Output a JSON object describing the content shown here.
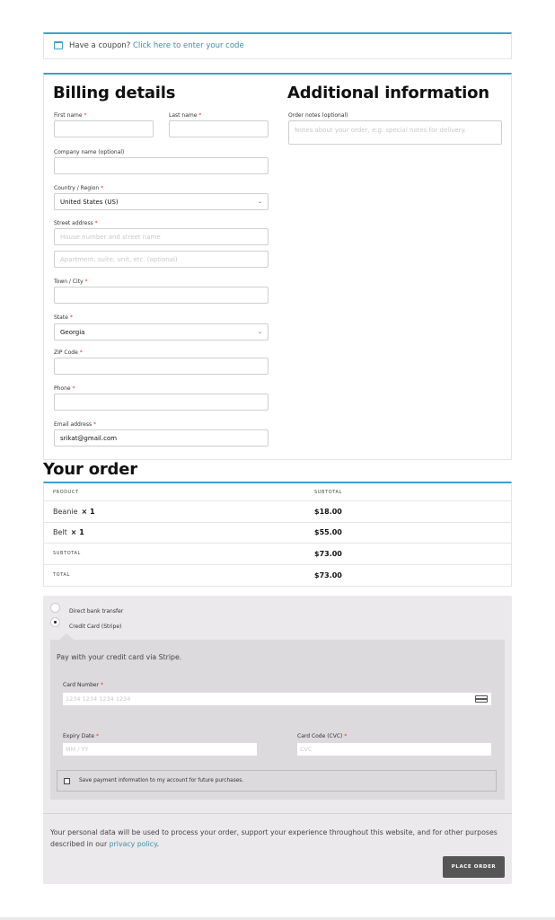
{
  "coupon": {
    "text": "Have a coupon?",
    "link": "Click here to enter your code"
  },
  "billing": {
    "title": "Billing details",
    "required_mark": "*",
    "first_name": {
      "label": "First name",
      "value": ""
    },
    "last_name": {
      "label": "Last name",
      "value": ""
    },
    "company": {
      "label": "Company name (optional)",
      "value": ""
    },
    "country": {
      "label": "Country / Region",
      "value": "United States (US)"
    },
    "street": {
      "label": "Street address",
      "placeholder1": "House number and street name",
      "placeholder2": "Apartment, suite, unit, etc. (optional)"
    },
    "city": {
      "label": "Town / City",
      "value": ""
    },
    "state": {
      "label": "State",
      "value": "Georgia"
    },
    "zip": {
      "label": "ZIP Code",
      "value": ""
    },
    "phone": {
      "label": "Phone",
      "value": ""
    },
    "email": {
      "label": "Email address",
      "value": "srikat@gmail.com"
    }
  },
  "additional": {
    "title": "Additional information",
    "notes_label": "Order notes (optional)",
    "notes_placeholder": "Notes about your order, e.g. special notes for delivery."
  },
  "order": {
    "title": "Your order",
    "col_product": "PRODUCT",
    "col_subtotal": "SUBTOTAL",
    "items": [
      {
        "name": "Beanie",
        "qty": "× 1",
        "price": "$18.00"
      },
      {
        "name": "Belt",
        "qty": "× 1",
        "price": "$55.00"
      }
    ],
    "subtotal_label": "SUBTOTAL",
    "subtotal_value": "$73.00",
    "total_label": "TOTAL",
    "total_value": "$73.00"
  },
  "payment": {
    "bank_label": "Direct bank transfer",
    "stripe_label": "Credit Card (Stripe)",
    "stripe_desc": "Pay with your credit card via Stripe.",
    "card_number_label": "Card Number",
    "card_number_placeholder": "1234 1234 1234 1234",
    "expiry_label": "Expiry Date",
    "expiry_placeholder": "MM / YY",
    "cvc_label": "Card Code (CVC)",
    "cvc_placeholder": "CVC",
    "save_label": "Save payment information to my account for future purchases.",
    "terms_text": "Your personal data will be used to process your order, support your experience throughout this website, and for other purposes described in our",
    "privacy_link": "privacy policy",
    "place_order": "PLACE ORDER"
  },
  "colors": {
    "accent": "#3ea1c9",
    "link": "#3f8fa7",
    "required": "#e2401c",
    "button": "#555555"
  }
}
